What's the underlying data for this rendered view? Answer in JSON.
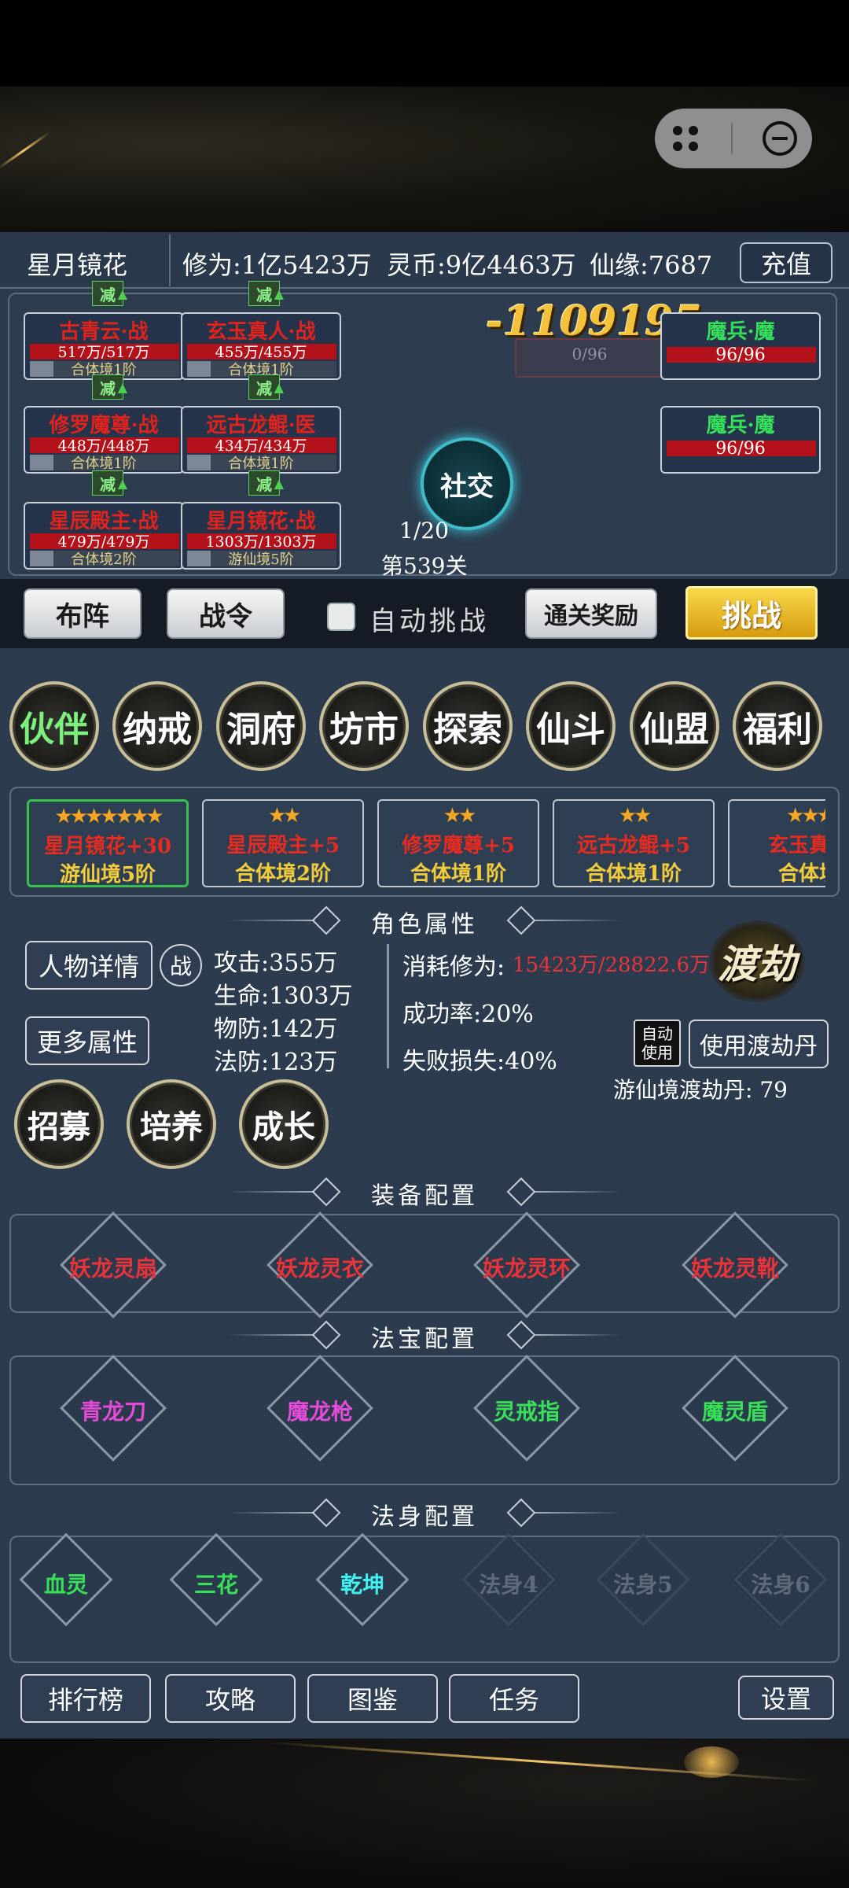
{
  "header": {
    "player_name": "星月镜花",
    "cultivation": "修为:1亿5423万",
    "spirit_coin": "灵币:9亿4463万",
    "fate": "仙缘:7687",
    "recharge_label": "充值"
  },
  "battle": {
    "allies": [
      {
        "name": "古青云·战",
        "hp": "517万/517万",
        "realm": "合体境1阶"
      },
      {
        "name": "玄玉真人·战",
        "hp": "455万/455万",
        "realm": "合体境1阶"
      },
      {
        "name": "修罗魔尊·战",
        "hp": "448万/448万",
        "realm": "合体境1阶"
      },
      {
        "name": "远古龙鲲·医",
        "hp": "434万/434万",
        "realm": "合体境1阶"
      },
      {
        "name": "星辰殿主·战",
        "hp": "479万/479万",
        "realm": "合体境2阶"
      },
      {
        "name": "星月镜花·战",
        "hp": "1303万/1303万",
        "realm": "游仙境5阶"
      }
    ],
    "buff_label": "减",
    "enemies": [
      {
        "name": "魔兵·魔",
        "hp": "96/96"
      },
      {
        "name": "魔兵·魔",
        "hp": "96/96"
      }
    ],
    "damage_popup": "-1109195",
    "wave_hp": "0/96",
    "social_label": "社交",
    "progress": "1/20",
    "stage": "第539关"
  },
  "actions": {
    "formation": "布阵",
    "battle_order": "战令",
    "auto_challenge": "自动挑战",
    "clear_reward": "通关奖励",
    "challenge": "挑战"
  },
  "menu": [
    "伙伴",
    "纳戒",
    "洞府",
    "坊市",
    "探索",
    "仙斗",
    "仙盟",
    "福利"
  ],
  "partners": [
    {
      "stars": "★★★★★★★",
      "name": "星月镜花+30",
      "realm": "游仙境5阶"
    },
    {
      "stars": "★★",
      "name": "星辰殿主+5",
      "realm": "合体境2阶"
    },
    {
      "stars": "★★",
      "name": "修罗魔尊+5",
      "realm": "合体境1阶"
    },
    {
      "stars": "★★",
      "name": "远古龙鲲+5",
      "realm": "合体境1阶"
    },
    {
      "stars": "★★★",
      "name": "玄玉真人",
      "realm": "合体境"
    }
  ],
  "attributes": {
    "section_title": "角色属性",
    "details_btn": "人物详情",
    "battle_tag": "战",
    "more_btn": "更多属性",
    "attack": "攻击:355万",
    "life": "生命:1303万",
    "pdef": "物防:142万",
    "mdef": "法防:123万",
    "cost_label": "消耗修为:",
    "cost_value": "15423万/28822.6万",
    "success": "成功率:20%",
    "fail_loss": "失败损失:40%",
    "tribulation": "渡劫",
    "auto_use": "自动使用",
    "use_pill": "使用渡劫丹",
    "pill_count": "游仙境渡劫丹: 79"
  },
  "growth_buttons": [
    "招募",
    "培养",
    "成长"
  ],
  "equipment": {
    "title": "装备配置",
    "items": [
      "妖龙灵扇",
      "妖龙灵衣",
      "妖龙灵环",
      "妖龙灵靴"
    ]
  },
  "treasure": {
    "title": "法宝配置",
    "items": [
      "青龙刀",
      "魔龙枪",
      "灵戒指",
      "魔灵盾"
    ]
  },
  "dharma": {
    "title": "法身配置",
    "items": [
      "血灵",
      "三花",
      "乾坤",
      "法身4",
      "法身5",
      "法身6"
    ]
  },
  "bottom_nav": [
    "排行榜",
    "攻略",
    "图鉴",
    "任务",
    "设置"
  ],
  "colors": {
    "panel": "#2c3b4e",
    "accent_gold": "#f4c23a",
    "red_text": "#e62b21",
    "green_text": "#38e05a"
  }
}
